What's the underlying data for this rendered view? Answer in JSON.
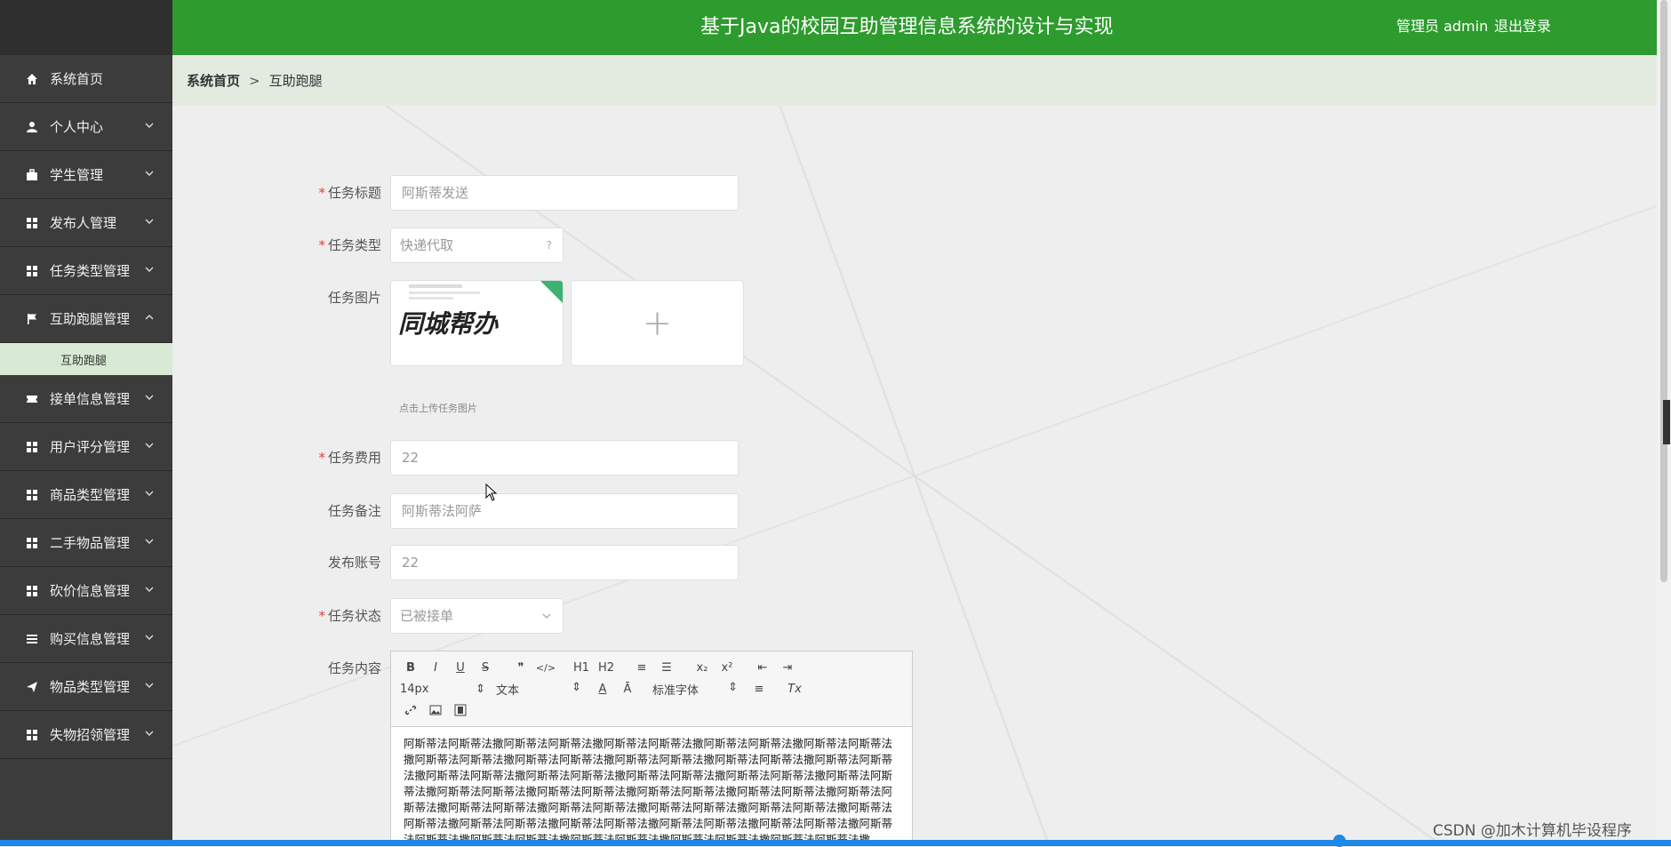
{
  "header": {
    "title": "基于Java的校园互助管理信息系统的设计与实现",
    "user": "管理员 admin",
    "logout": "退出登录",
    "color": "#2e9b2e"
  },
  "sidebar": {
    "items": [
      {
        "label": "系统首页",
        "icon": "home-icon"
      },
      {
        "label": "个人中心",
        "icon": "user-icon"
      },
      {
        "label": "学生管理",
        "icon": "briefcase-icon"
      },
      {
        "label": "发布人管理",
        "icon": "grid-icon"
      },
      {
        "label": "任务类型管理",
        "icon": "grid-icon"
      },
      {
        "label": "互助跑腿管理",
        "icon": "flag-icon",
        "expanded": true,
        "sub": "互助跑腿"
      },
      {
        "label": "接单信息管理",
        "icon": "ticket-icon"
      },
      {
        "label": "用户评分管理",
        "icon": "grid-icon"
      },
      {
        "label": "商品类型管理",
        "icon": "grid-icon"
      },
      {
        "label": "二手物品管理",
        "icon": "grid-icon"
      },
      {
        "label": "砍价信息管理",
        "icon": "grid-icon"
      },
      {
        "label": "购买信息管理",
        "icon": "list-icon"
      },
      {
        "label": "物品类型管理",
        "icon": "send-icon"
      },
      {
        "label": "失物招领管理",
        "icon": "grid-icon"
      }
    ]
  },
  "breadcrumb": {
    "home": "系统首页",
    "separator": ">",
    "current": "互助跑腿"
  },
  "form": {
    "title_label": "任务标题",
    "title_value": "阿斯蒂发送",
    "type_label": "任务类型",
    "type_value": "快递代取",
    "type_arrow": "?",
    "image_label": "任务图片",
    "image_text": "同城帮办",
    "upload_hint": "点击上传任务图片",
    "upload_plus": "+",
    "fee_label": "任务费用",
    "fee_value": "22",
    "note_label": "任务备注",
    "note_value": "阿斯蒂法阿萨",
    "account_label": "发布账号",
    "account_value": "22",
    "status_label": "任务状态",
    "status_value": "已被接单",
    "content_label": "任务内容",
    "required_mark": "*"
  },
  "editor": {
    "font_size": "14px",
    "paragraph": "文本",
    "font_family": "标准字体",
    "row1": [
      "B",
      "I",
      "U",
      "S",
      "❞",
      "</>",
      "H1",
      "H2",
      "≡",
      "☰",
      "x₂",
      "x²",
      "⇤",
      "⇥"
    ],
    "row2_icons": [
      "A",
      "Ā",
      "≡",
      "Tx"
    ],
    "content": "阿斯蒂法阿斯蒂法撒阿斯蒂法阿斯蒂法撒阿斯蒂法阿斯蒂法撒阿斯蒂法阿斯蒂法撒阿斯蒂法阿斯蒂法撒阿斯蒂法阿斯蒂法撒阿斯蒂法阿斯蒂法撒阿斯蒂法阿斯蒂法撒阿斯蒂法阿斯蒂法撒阿斯蒂法阿斯蒂法撒阿斯蒂法阿斯蒂法撒阿斯蒂法阿斯蒂法撒阿斯蒂法阿斯蒂法撒阿斯蒂法阿斯蒂法撒阿斯蒂法阿斯蒂法撒阿斯蒂法阿斯蒂法撒阿斯蒂法阿斯蒂法撒阿斯蒂法阿斯蒂法撒阿斯蒂法阿斯蒂法撒阿斯蒂法阿斯蒂法撒阿斯蒂法阿斯蒂法撒阿斯蒂法阿斯蒂法撒阿斯蒂法阿斯蒂法撒阿斯蒂法阿斯蒂法撒阿斯蒂法阿斯蒂法撒阿斯蒂法阿斯蒂法撒阿斯蒂法阿斯蒂法撒阿斯蒂法阿斯蒂法撒阿斯蒂法阿斯蒂法撒阿斯蒂法阿斯蒂法撒阿斯蒂法阿斯蒂法撒阿斯蒂法阿斯蒂法撒阿斯蒂法阿斯蒂法撒阿斯蒂法阿斯蒂法撒"
  },
  "watermark": "CSDN @加木计算机毕设程序"
}
